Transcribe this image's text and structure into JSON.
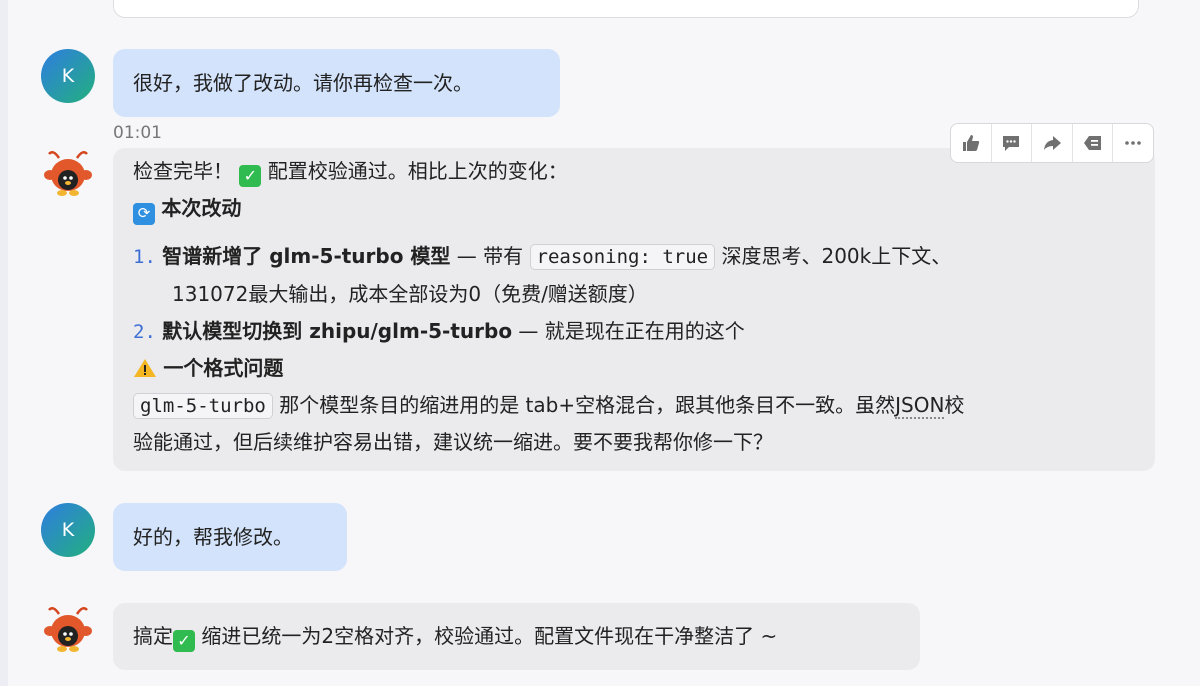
{
  "user": {
    "avatar_letter": "K"
  },
  "messages": {
    "m1": {
      "text": "很好，我做了改动。请你再检查一次。",
      "time": "01:01"
    },
    "m2": {
      "intro_prefix": "检查完毕！",
      "intro_suffix": "配置校验通过。相比上次的变化：",
      "section1_title": "本次改动",
      "item1": {
        "num": "1.",
        "bold": "智谱新增了 glm-5-turbo 模型",
        "dash": " — 带有 ",
        "code": "reasoning: true",
        "rest": " 深度思考、200k上下文、",
        "line2": "131072最大输出，成本全部设为0（免费/赠送额度）"
      },
      "item2": {
        "num": "2.",
        "bold": "默认模型切换到 zhipu/glm-5-turbo",
        "rest": " — 就是现在正在用的这个"
      },
      "section2_title": "一个格式问题",
      "issue": {
        "code": "glm-5-turbo",
        "line1_text": " 那个模型条目的缩进用的是 tab+空格混合，跟其他条目不一致。虽然",
        "line1_json": "JSON",
        "line1_end": "校",
        "line2": "验能通过，但后续维护容易出错，建议统一缩进。要不要我帮你修一下？"
      }
    },
    "m3": {
      "text": "好的，帮我修改。"
    },
    "m4": {
      "prefix": "搞定",
      "suffix": " 缩进已统一为2空格对齐，校验通过。配置文件现在干净整洁了 ~"
    }
  },
  "actions": [
    {
      "name": "thumbs-up-icon"
    },
    {
      "name": "comment-icon"
    },
    {
      "name": "share-icon"
    },
    {
      "name": "quote-icon"
    },
    {
      "name": "more-icon"
    }
  ],
  "colors": {
    "user_bubble": "#d3e3fb",
    "bot_bubble": "#ebebed",
    "accent": "#3d6fd6",
    "check": "#2fbb4f"
  }
}
